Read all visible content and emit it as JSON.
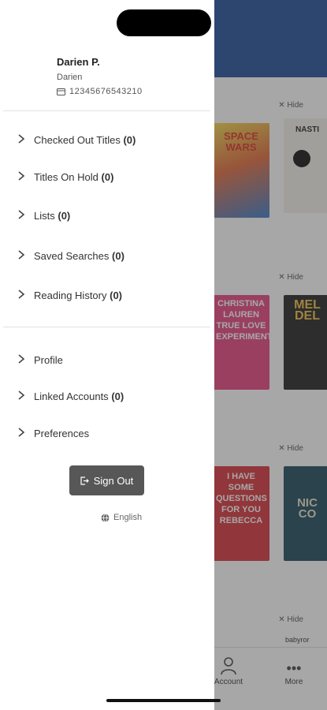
{
  "drawer": {
    "user_name": "Darien P.",
    "user_sub": "Darien",
    "card_number": "12345676543210",
    "menu": [
      {
        "label": "Checked Out Titles",
        "count": "(0)"
      },
      {
        "label": "Titles On Hold",
        "count": "(0)"
      },
      {
        "label": "Lists",
        "count": "(0)"
      },
      {
        "label": "Saved Searches",
        "count": "(0)"
      },
      {
        "label": "Reading History",
        "count": "(0)"
      }
    ],
    "menu2": [
      {
        "label": "Profile",
        "count": ""
      },
      {
        "label": "Linked Accounts",
        "count": "(0)"
      },
      {
        "label": "Preferences",
        "count": ""
      }
    ],
    "sign_out_label": "Sign Out",
    "language": "English"
  },
  "background": {
    "hide_label": "Hide",
    "covers": [
      {
        "text": "SPACE WARS",
        "color": "#e8c83a"
      },
      {
        "text": "NASTI",
        "color": "#f4f1ea"
      },
      {
        "text": "CHRISTINA LAUREN TRUE LOVE EXPERIMENT",
        "color": "#e8437f"
      },
      {
        "text": "MEL DEL",
        "color": "#222222"
      },
      {
        "text": "I HAVE SOME QUESTIONS FOR YOU REBECCA",
        "color": "#d8323a"
      },
      {
        "text": "NIC CO",
        "color": "#1d4a5a"
      }
    ],
    "bottom_nav": [
      {
        "label": "Account",
        "icon": "person-icon"
      },
      {
        "label": "More",
        "icon": "more-icon"
      }
    ],
    "partial_label": "babyror"
  },
  "colors": {
    "header": "#1f4f9c",
    "button": "#575757",
    "moon": "#1f4f9c"
  }
}
